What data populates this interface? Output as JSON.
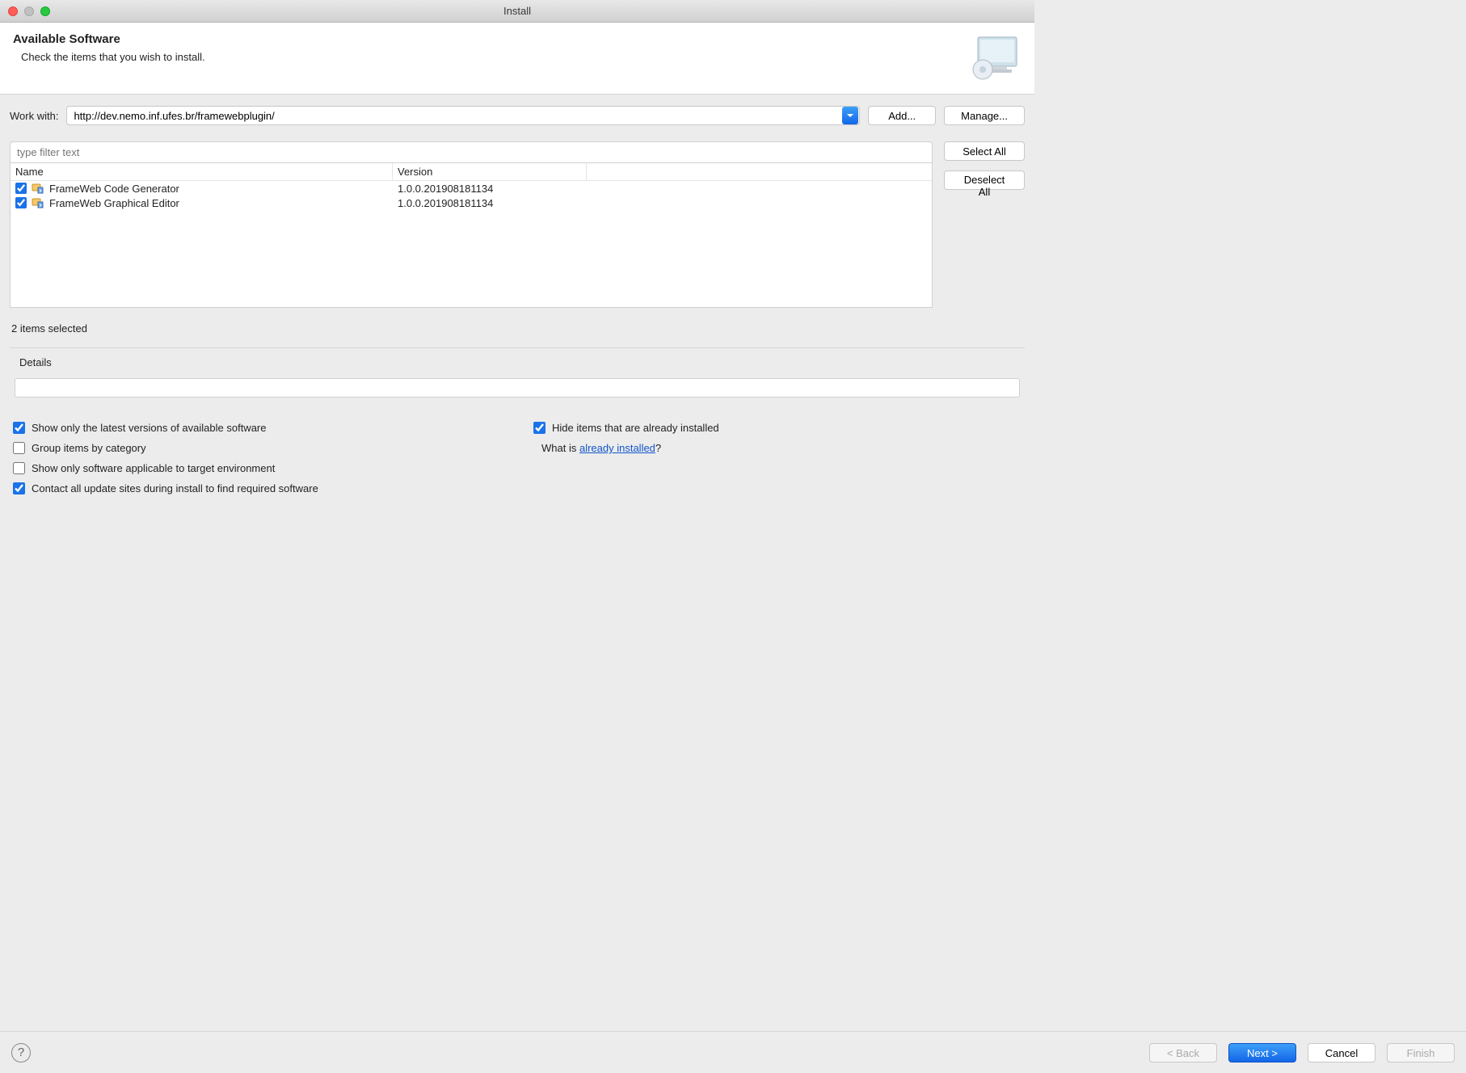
{
  "window": {
    "title": "Install"
  },
  "header": {
    "title": "Available Software",
    "subtitle": "Check the items that you wish to install."
  },
  "work_with": {
    "label": "Work with:",
    "value": "http://dev.nemo.inf.ufes.br/framewebplugin/",
    "add_label": "Add...",
    "manage_label": "Manage..."
  },
  "filter": {
    "placeholder": "type filter text"
  },
  "columns": {
    "name": "Name",
    "version": "Version"
  },
  "items": [
    {
      "checked": true,
      "name": "FrameWeb Code Generator",
      "version": "1.0.0.201908181134"
    },
    {
      "checked": true,
      "name": "FrameWeb Graphical Editor",
      "version": "1.0.0.201908181134"
    }
  ],
  "side_buttons": {
    "select_all": "Select All",
    "deselect_all": "Deselect All"
  },
  "selection_status": "2 items selected",
  "details": {
    "label": "Details"
  },
  "options": {
    "show_latest": "Show only the latest versions of available software",
    "group_by_category": "Group items by category",
    "show_applicable": "Show only software applicable to target environment",
    "contact_sites": "Contact all update sites during install to find required software",
    "hide_installed": "Hide items that are already installed",
    "whatis_prefix": "What is ",
    "whatis_link": "already installed",
    "whatis_suffix": "?"
  },
  "footer": {
    "back": "< Back",
    "next": "Next >",
    "cancel": "Cancel",
    "finish": "Finish"
  }
}
